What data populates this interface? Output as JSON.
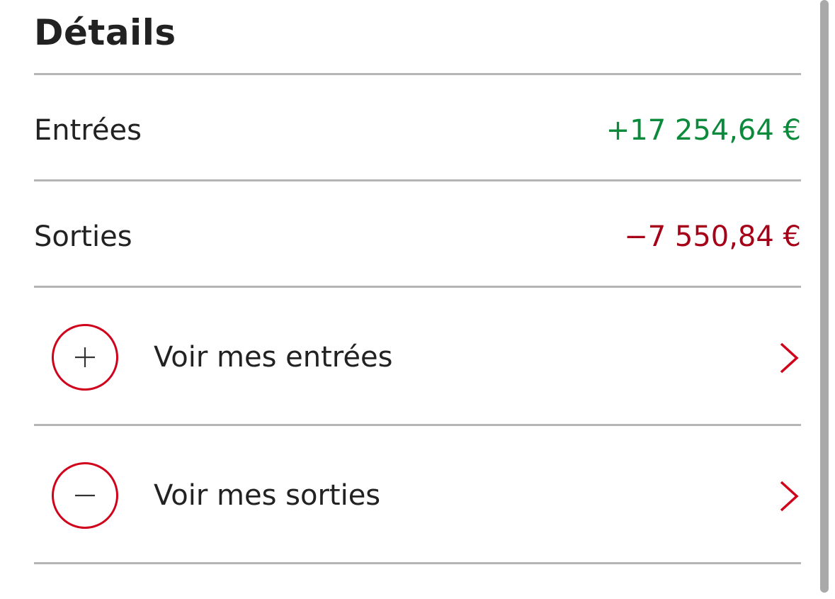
{
  "details": {
    "title": "Détails"
  },
  "summary": {
    "entrees": {
      "label": "Entrées",
      "amount": "+17 254,64 €"
    },
    "sorties": {
      "label": "Sorties",
      "amount": "−7 550,84 €"
    }
  },
  "links": {
    "entrees": {
      "label": "Voir mes entrées",
      "icon": "plus-icon"
    },
    "sorties": {
      "label": "Voir mes sorties",
      "icon": "minus-icon"
    }
  },
  "colors": {
    "positive": "#0a8a3a",
    "negative": "#a50018",
    "accent": "#d0021b"
  }
}
